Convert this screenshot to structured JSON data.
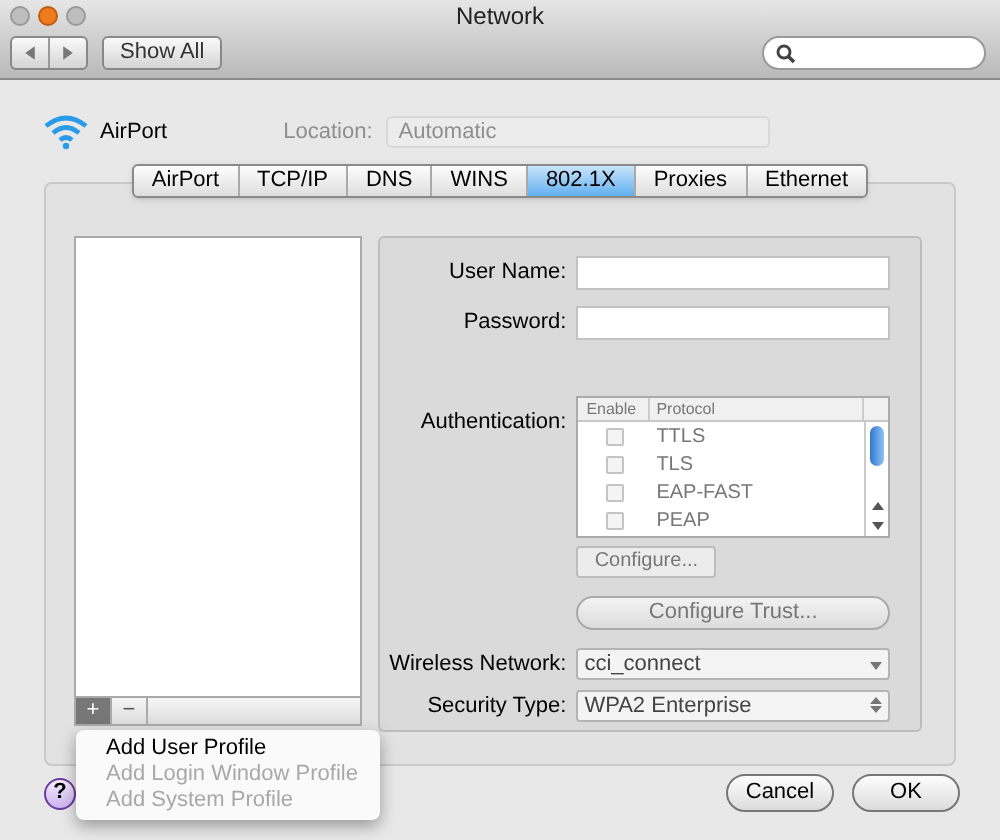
{
  "window": {
    "title": "Network"
  },
  "toolbar": {
    "show_all": "Show All"
  },
  "service": {
    "name": "AirPort"
  },
  "location": {
    "label": "Location:",
    "value": "Automatic"
  },
  "tabs": [
    {
      "label": "AirPort",
      "selected": false
    },
    {
      "label": "TCP/IP",
      "selected": false
    },
    {
      "label": "DNS",
      "selected": false
    },
    {
      "label": "WINS",
      "selected": false
    },
    {
      "label": "802.1X",
      "selected": true
    },
    {
      "label": "Proxies",
      "selected": false
    },
    {
      "label": "Ethernet",
      "selected": false
    }
  ],
  "form": {
    "user_name": {
      "label": "User Name:"
    },
    "password": {
      "label": "Password:"
    },
    "authentication": {
      "label": "Authentication:",
      "columns": [
        "Enable",
        "Protocol"
      ],
      "rows": [
        {
          "protocol": "TTLS",
          "checked": false
        },
        {
          "protocol": "TLS",
          "checked": false
        },
        {
          "protocol": "EAP-FAST",
          "checked": false
        },
        {
          "protocol": "PEAP",
          "checked": false
        }
      ]
    },
    "configure": "Configure...",
    "configure_trust": "Configure Trust...",
    "wireless_network": {
      "label": "Wireless Network:",
      "value": "cci_connect"
    },
    "security_type": {
      "label": "Security Type:",
      "value": "WPA2 Enterprise"
    }
  },
  "list_buttons": [
    "+",
    "−"
  ],
  "menu": {
    "items": [
      {
        "label": "Add User Profile",
        "disabled": false
      },
      {
        "label": "Add Login Window Profile",
        "disabled": true
      },
      {
        "label": "Add System Profile",
        "disabled": true
      }
    ]
  },
  "help": "?",
  "buttons": [
    "Cancel",
    "OK"
  ]
}
